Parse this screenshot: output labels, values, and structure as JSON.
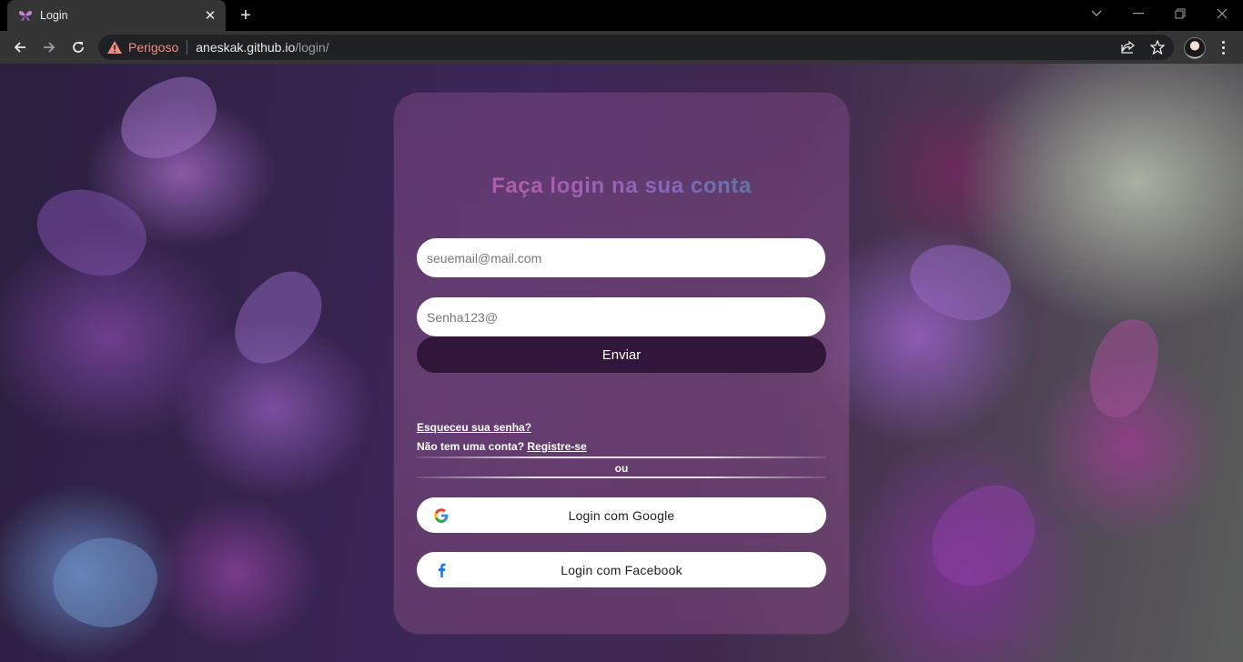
{
  "browser": {
    "tab_title": "Login",
    "tab_close": "✕",
    "new_tab": "+",
    "security_label": "Perigoso",
    "url_host": "aneskak.github.io",
    "url_path": "/login/"
  },
  "login": {
    "title": "Faça login na sua conta",
    "email_placeholder": "seuemail@mail.com",
    "password_placeholder": "Senha123@",
    "submit_label": "Enviar",
    "forgot_link": "Esqueceu sua senha?",
    "no_account_text": "Não tem uma conta?",
    "register_link": "Registre-se",
    "or_label": "ou",
    "google_label": "Login com Google",
    "facebook_label": "Login com Facebook"
  },
  "colors": {
    "submit_bg": "#32163a",
    "danger": "#f28b82",
    "facebook_blue": "#1877f2"
  },
  "icons": [
    "butterfly-favicon-icon",
    "close-icon",
    "plus-icon",
    "chevron-down-icon",
    "minimize-icon",
    "restore-icon",
    "window-close-icon",
    "back-arrow-icon",
    "forward-arrow-icon",
    "reload-icon",
    "warning-icon",
    "share-icon",
    "star-icon",
    "avatar",
    "kebab-menu-icon",
    "google-icon",
    "facebook-icon"
  ]
}
